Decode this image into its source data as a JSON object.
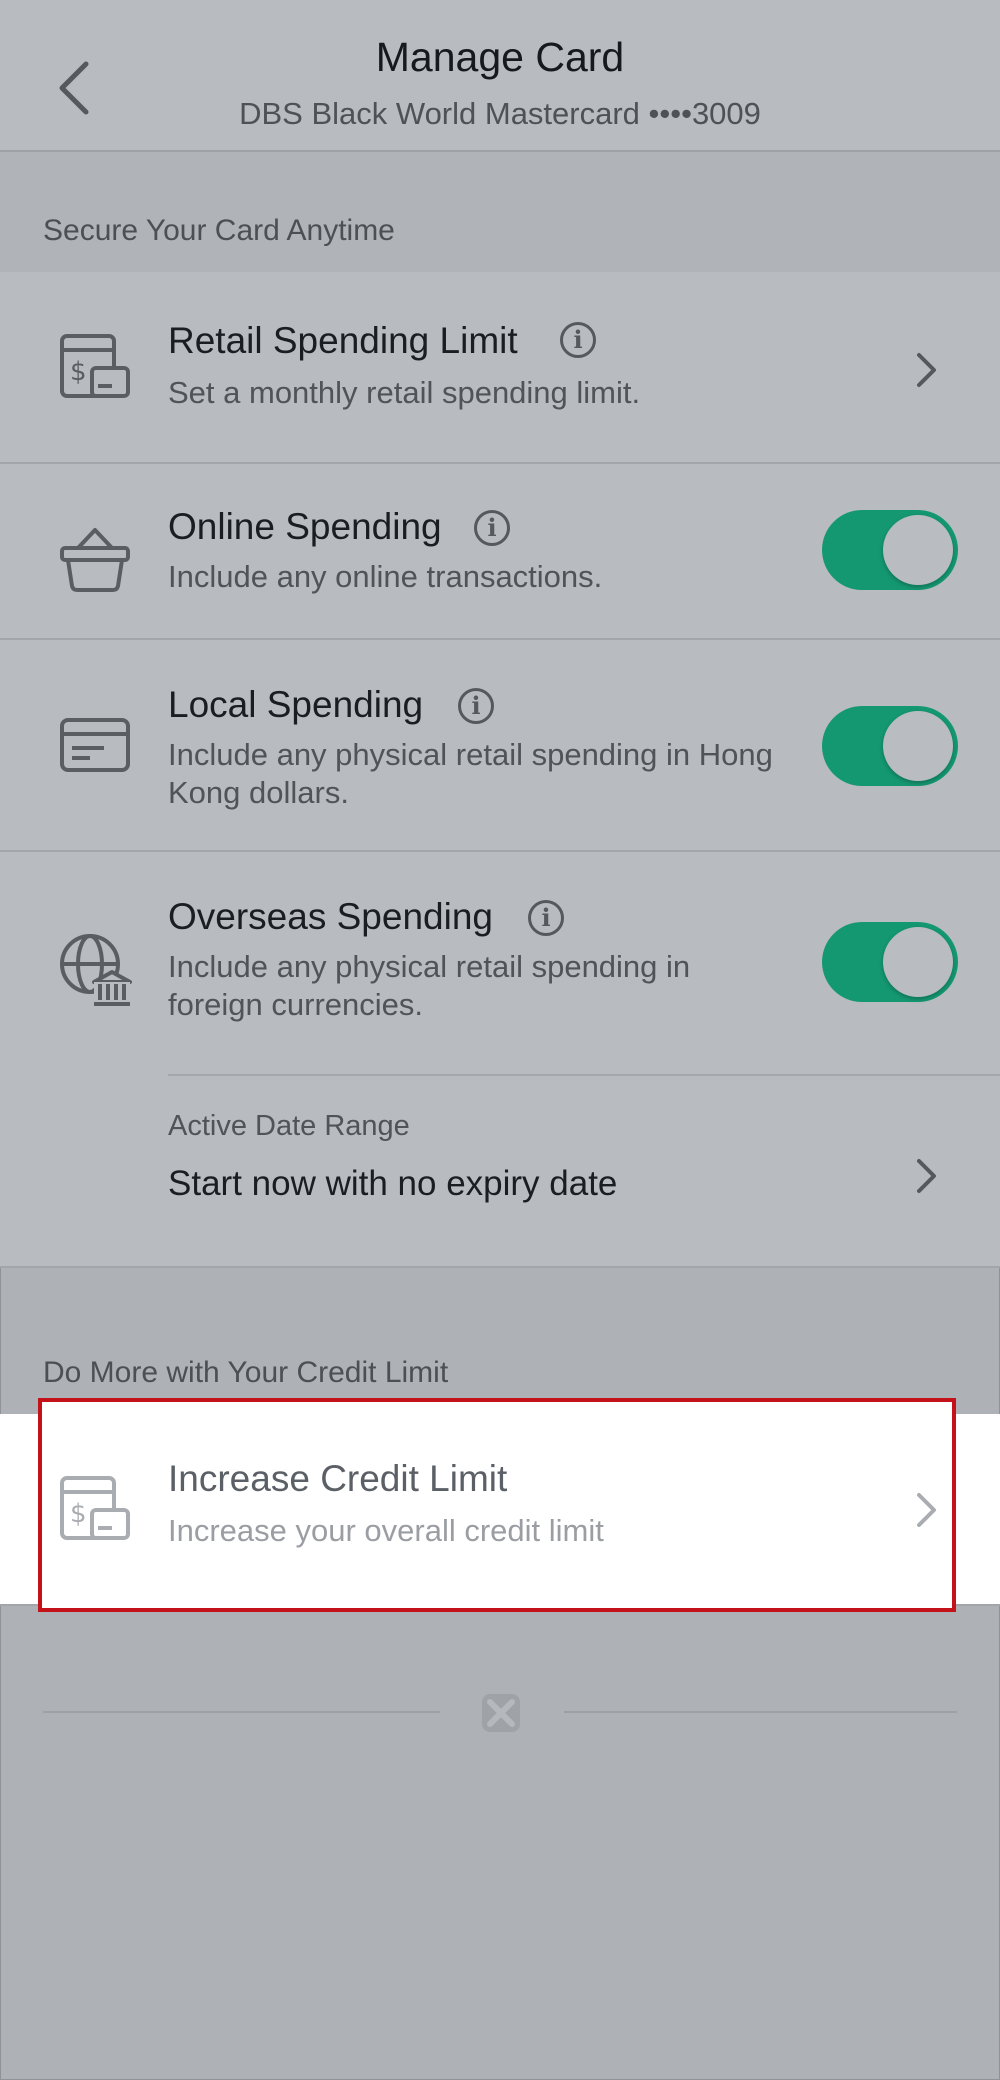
{
  "header": {
    "title": "Manage Card",
    "subtitle": "DBS Black World Mastercard ••••3009"
  },
  "secure_section": {
    "label": "Secure Your Card Anytime",
    "items": [
      {
        "title": "Retail Spending Limit",
        "description": "Set a monthly retail spending limit.",
        "icon": "dollar-card-icon"
      },
      {
        "title": "Online Spending",
        "description": "Include any online transactions.",
        "icon": "basket-icon",
        "toggle_on": true
      },
      {
        "title": "Local Spending",
        "description": "Include any physical retail spending in Hong Kong dollars.",
        "icon": "card-icon",
        "toggle_on": true
      },
      {
        "title": "Overseas Spending",
        "description": "Include any physical retail spending in foreign currencies.",
        "icon": "globe-bank-icon",
        "toggle_on": true
      }
    ],
    "date_range": {
      "label": "Active Date Range",
      "value": "Start now with no expiry date"
    }
  },
  "credit_section": {
    "label": "Do More with Your Credit Limit",
    "item": {
      "title": "Increase Credit Limit",
      "description": "Increase your overall credit limit",
      "icon": "dollar-card-icon"
    }
  },
  "colors": {
    "toggle_on": "#149871",
    "highlight_border": "#c4121b"
  }
}
